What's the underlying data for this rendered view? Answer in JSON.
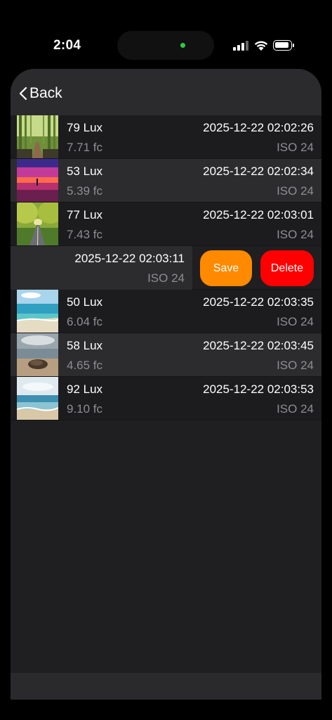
{
  "status": {
    "time": "2:04"
  },
  "nav": {
    "back_label": "Back"
  },
  "readings": [
    {
      "lux": "79 Lux",
      "fc": "7.71 fc",
      "date": "2025-12-22 02:02:26",
      "iso": "ISO 24",
      "thumb": "bamboo-path"
    },
    {
      "lux": "53 Lux",
      "fc": "5.39 fc",
      "date": "2025-12-22 02:02:34",
      "iso": "ISO 24",
      "thumb": "sunset-sea"
    },
    {
      "lux": "77 Lux",
      "fc": "7.43 fc",
      "date": "2025-12-22 02:03:01",
      "iso": "ISO 24",
      "thumb": "tree-tunnel-road"
    },
    {
      "lux": "",
      "fc": "",
      "date": "2025-12-22 02:03:11",
      "iso": "ISO 24",
      "thumb": ""
    },
    {
      "lux": "50 Lux",
      "fc": "6.04 fc",
      "date": "2025-12-22 02:03:35",
      "iso": "ISO 24",
      "thumb": "tropical-beach"
    },
    {
      "lux": "58 Lux",
      "fc": "4.65 fc",
      "date": "2025-12-22 02:03:45",
      "iso": "ISO 24",
      "thumb": "rock-shore"
    },
    {
      "lux": "92 Lux",
      "fc": "9.10 fc",
      "date": "2025-12-22 02:03:53",
      "iso": "ISO 24",
      "thumb": "ocean-waves"
    }
  ],
  "swipe_actions": {
    "save_label": "Save",
    "delete_label": "Delete",
    "save_color": "#ff8a00",
    "delete_color": "#ff0000"
  }
}
